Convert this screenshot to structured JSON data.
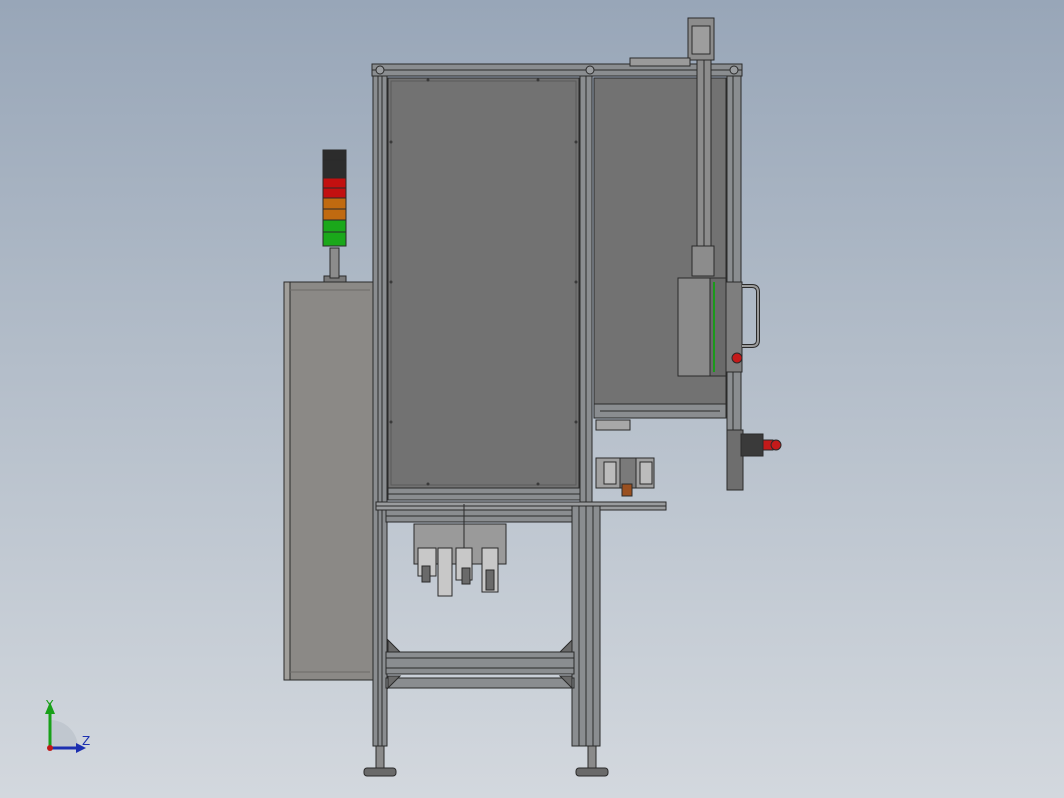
{
  "viewport": {
    "background_top": "#98a6b8",
    "background_bottom": "#d3d8de"
  },
  "triad": {
    "y_label": "Y",
    "z_label": "Z",
    "y_color": "#18a018",
    "z_color": "#1c2fb0",
    "origin_color": "#c01818"
  },
  "signal_tower": {
    "segments": [
      "black",
      "red",
      "orange",
      "green"
    ],
    "colors": {
      "black": "#2c2c2c",
      "red": "#c21010",
      "orange": "#c06a10",
      "green": "#1aa81a"
    }
  },
  "colors": {
    "frame_profile": "#8a8d90",
    "frame_edge": "#2a2a2a",
    "panel_dark": "#727272",
    "cabinet": "#8b8986",
    "estop": "#c41a1a"
  }
}
